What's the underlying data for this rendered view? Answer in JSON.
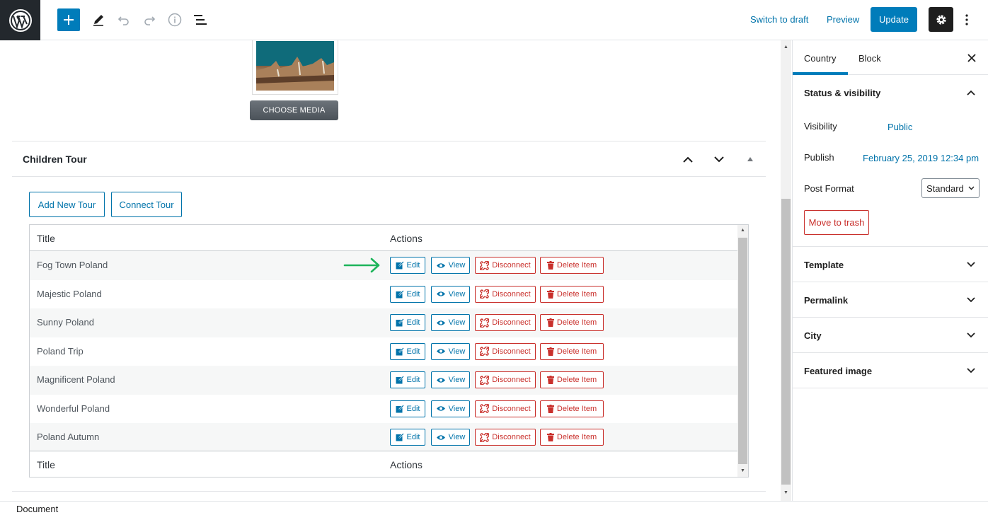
{
  "toolbar": {
    "switch_to_draft": "Switch to draft",
    "preview": "Preview",
    "update": "Update"
  },
  "media": {
    "choose_label": "CHOOSE MEDIA"
  },
  "panel": {
    "title": "Children Tour",
    "add_new": "Add New Tour",
    "connect": "Connect Tour"
  },
  "table": {
    "header_title": "Title",
    "header_actions": "Actions",
    "footer_title": "Title",
    "footer_actions": "Actions",
    "actions": {
      "edit": "Edit",
      "view": "View",
      "disconnect": "Disconnect",
      "delete": "Delete Item"
    },
    "rows": [
      {
        "title": "Fog Town Poland"
      },
      {
        "title": "Majestic Poland"
      },
      {
        "title": "Sunny Poland"
      },
      {
        "title": "Poland Trip"
      },
      {
        "title": "Magnificent Poland"
      },
      {
        "title": "Wonderful Poland"
      },
      {
        "title": "Poland Autumn"
      }
    ]
  },
  "footer": {
    "label": "Document"
  },
  "sidebar": {
    "tab_country": "Country",
    "tab_block": "Block",
    "status_title": "Status & visibility",
    "visibility_label": "Visibility",
    "visibility_value": "Public",
    "publish_label": "Publish",
    "publish_value": "February 25, 2019 12:34 pm",
    "post_format_label": "Post Format",
    "post_format_value": "Standard",
    "trash": "Move to trash",
    "sections": [
      "Template",
      "Permalink",
      "City",
      "Featured image"
    ]
  },
  "colors": {
    "accent": "#007cba",
    "link": "#0073aa",
    "danger": "#c9302c",
    "arrow": "#1db45a",
    "dark": "#23282d"
  }
}
